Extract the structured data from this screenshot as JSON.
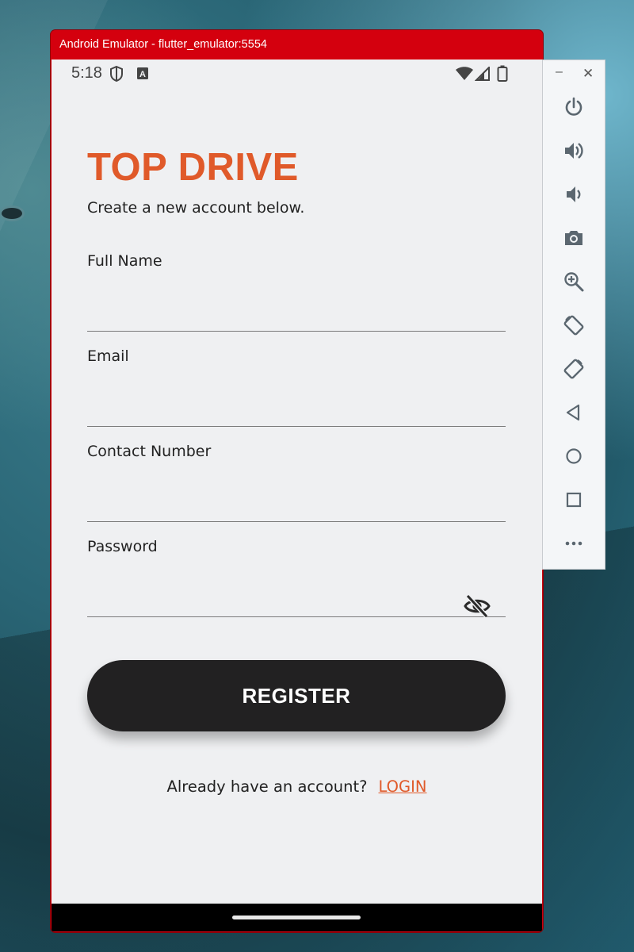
{
  "window": {
    "title": "Android Emulator - flutter_emulator:5554"
  },
  "status_bar": {
    "time": "5:18"
  },
  "app": {
    "title": "TOP DRIVE",
    "subtitle": "Create a new account below.",
    "fields": [
      {
        "label": "Full Name",
        "value": ""
      },
      {
        "label": "Email",
        "value": ""
      },
      {
        "label": "Contact Number",
        "value": ""
      },
      {
        "label": "Password",
        "value": ""
      }
    ],
    "register_label": "REGISTER",
    "login_prompt": "Already have an account?",
    "login_link": "LOGIN"
  },
  "colors": {
    "brand": "#e05a2a",
    "button": "#222122",
    "screen_bg": "#eff0f2",
    "titlebar": "#d4000e"
  },
  "side_panel": {
    "tools": [
      "power-icon",
      "volume-up-icon",
      "volume-down-icon",
      "camera-icon",
      "zoom-icon",
      "rotate-left-icon",
      "rotate-right-icon",
      "back-icon",
      "home-icon",
      "overview-icon",
      "more-icon"
    ]
  }
}
